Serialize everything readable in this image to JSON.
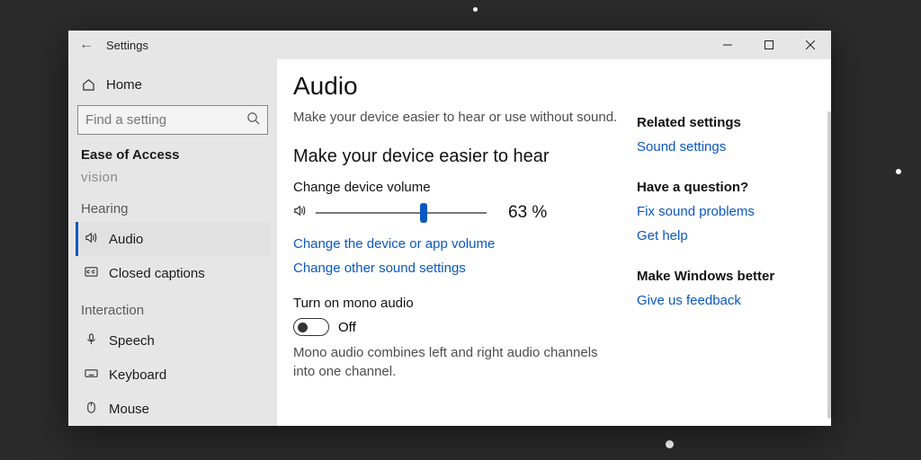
{
  "window_title": "Settings",
  "search_placeholder": "Find a setting",
  "sidebar": {
    "home": "Home",
    "category": "Ease of Access",
    "faded_above": "vision",
    "groups": [
      {
        "label": "Hearing",
        "items": [
          {
            "id": "audio",
            "label": "Audio",
            "active": true
          },
          {
            "id": "closed-captions",
            "label": "Closed captions",
            "active": false
          }
        ]
      },
      {
        "label": "Interaction",
        "items": [
          {
            "id": "speech",
            "label": "Speech",
            "active": false
          },
          {
            "id": "keyboard",
            "label": "Keyboard",
            "active": false
          },
          {
            "id": "mouse",
            "label": "Mouse",
            "active": false
          }
        ]
      }
    ]
  },
  "page": {
    "title": "Audio",
    "subtitle": "Make your device easier to hear or use without sound.",
    "hear_heading": "Make your device easier to hear",
    "volume_label": "Change device volume",
    "volume_value": 63,
    "volume_display": "63 %",
    "link_device_app_volume": "Change the device or app volume",
    "link_other_sound": "Change other sound settings",
    "mono_heading": "Turn on mono audio",
    "mono_state": "Off",
    "mono_help": "Mono audio combines left and right audio channels into one channel."
  },
  "aside": {
    "related_heading": "Related settings",
    "related_link": "Sound settings",
    "question_heading": "Have a question?",
    "question_links": [
      "Fix sound problems",
      "Get help"
    ],
    "better_heading": "Make Windows better",
    "better_link": "Give us feedback"
  }
}
